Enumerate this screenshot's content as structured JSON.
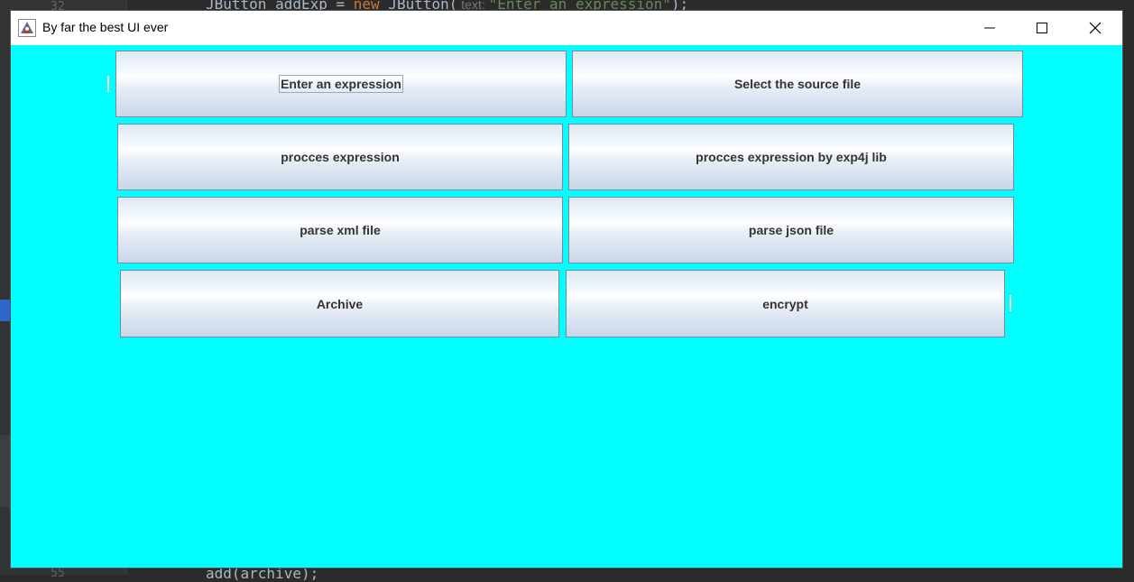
{
  "ide": {
    "top_line_number": "32",
    "top_code": [
      "JButton addExp = ",
      "new",
      " JButton(",
      " text: ",
      "\"Enter an expression\"",
      ");"
    ],
    "bottom_line_number": "55",
    "bottom_code": "add(archive);"
  },
  "window": {
    "title": "By far the best UI ever",
    "icon": "java-duke-icon",
    "controls": {
      "minimize": "minimize-icon",
      "maximize": "maximize-icon",
      "close": "close-icon"
    },
    "background_color": "#00ffff"
  },
  "buttons": [
    {
      "id": "enter-expression",
      "label": "Enter an expression",
      "focused": true
    },
    {
      "id": "select-source-file",
      "label": "Select the source file",
      "focused": false
    },
    {
      "id": "procces-expression",
      "label": "procces expression",
      "focused": false
    },
    {
      "id": "procces-expression-exp4j",
      "label": "procces expression by exp4j lib",
      "focused": false
    },
    {
      "id": "parse-xml-file",
      "label": "parse xml file",
      "focused": false
    },
    {
      "id": "parse-json-file",
      "label": "parse json file",
      "focused": false
    },
    {
      "id": "archive",
      "label": "Archive",
      "focused": false
    },
    {
      "id": "encrypt",
      "label": "encrypt",
      "focused": false
    }
  ]
}
